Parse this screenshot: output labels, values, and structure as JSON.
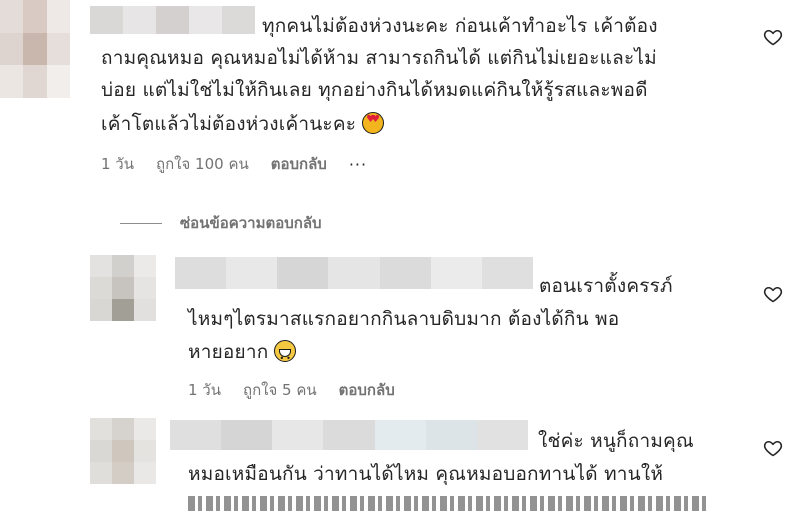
{
  "comments": [
    {
      "lines": [
        "ทุกคนไม่ต้องห่วงนะคะ ก่อนเค้าทำอะไร เค้าต้อง",
        "ถามคุณหมอ คุณหมอไม่ได้ห้าม สามารถกินได้ แต่กินไม่เยอะและไม่",
        "บ่อย แต่ไม่ใช่ไม่ให้กินเลย ทุกอย่างกินได้หมดแค่กินให้รู้รสและพอดี",
        "เค้าโตแล้วไม่ต้องห่วงเค้านะคะ"
      ],
      "time": "1 วัน",
      "likes": "ถูกใจ 100 คน",
      "reply": "ตอบกลับ",
      "emoji": "smiling-face-with-heart-eyes"
    },
    {
      "lines": [
        "ตอนเราตั้งครรภ์",
        "ไหมๆไตรมาสแรกอยากกินลาบดิบมาก ต้องได้กิน พอ",
        "หายอยาก"
      ],
      "time": "1 วัน",
      "likes": "ถูกใจ 5 คน",
      "reply": "ตอบกลับ",
      "emoji": "grinning-face"
    },
    {
      "lines": [
        "ใช่ค่ะ หนูก็ถามคุณ",
        "หมอเหมือนกัน ว่าทานได้ไหม คุณหมอบอกทานได้ ทานให้"
      ]
    }
  ],
  "hide_replies_label": "ซ่อนข้อความตอบกลับ",
  "icons": {
    "like": "heart-outline-icon",
    "more": "more-dots-icon"
  },
  "colors": {
    "text": "#262626",
    "secondary": "#737373",
    "heart_stroke": "#262626"
  }
}
